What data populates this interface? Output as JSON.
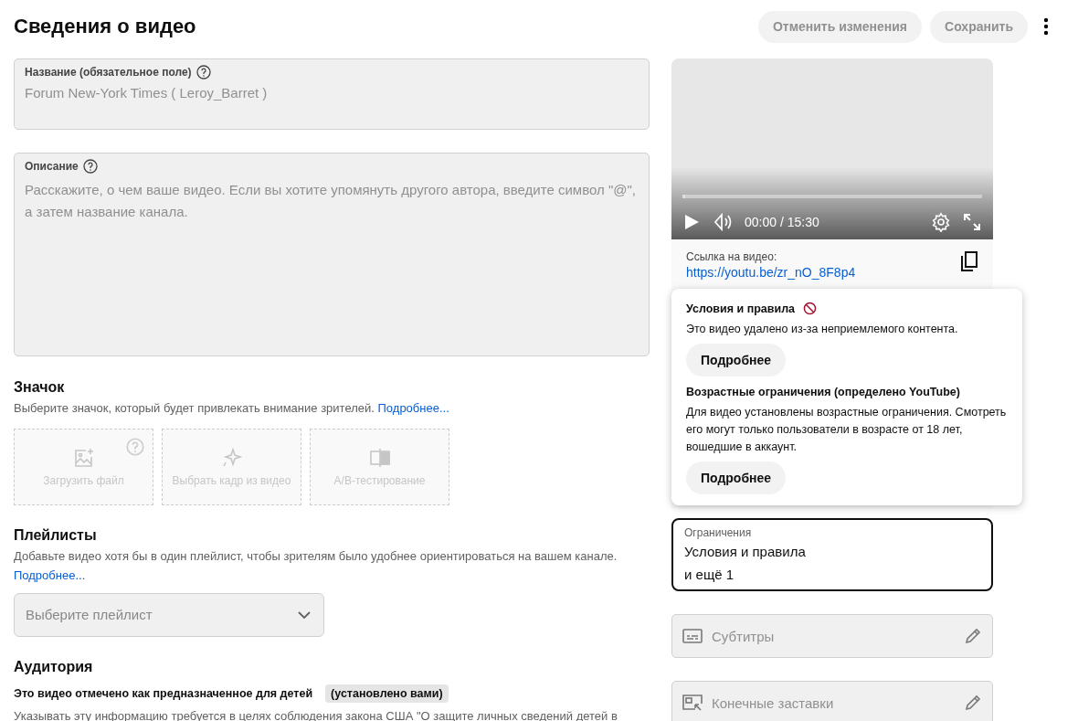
{
  "header": {
    "title": "Сведения о видео",
    "buttons": [
      "Отменить изменения",
      "Сохранить"
    ]
  },
  "title_field": {
    "label": "Название (обязательное поле)",
    "value": "Forum New-York Times ( Leroy_Barret )"
  },
  "description_field": {
    "label": "Описание",
    "placeholder": "Расскажите, о чем ваше видео. Если вы хотите упомянуть другого автора, введите символ \"@\", а затем название канала."
  },
  "thumbnail": {
    "heading": "Значок",
    "text": "Выберите значок, который будет привлекать внимание зрителей.",
    "link": "Подробнее...",
    "tiles": [
      {
        "kind": "upload",
        "label": "Загрузить файл"
      },
      {
        "kind": "frame",
        "label": "Выбрать кадр из видео"
      },
      {
        "kind": "ab",
        "label": "A/B-тестирование"
      }
    ]
  },
  "playlists": {
    "heading": "Плейлисты",
    "text": "Добавьте видео хотя бы в один плейлист, чтобы зрителям было удобнее ориентироваться на вашем канале.",
    "link": "Подробнее...",
    "placeholder": "Выберите плейлист"
  },
  "audience": {
    "heading": "Аудитория",
    "status": "Это видео отмечено как предназначенное для детей",
    "chip": "(установлено вами)",
    "note": "Указывать эту информацию требуется в целях соблюдения закона США \"О защите личных сведений детей в"
  },
  "video": {
    "time": "00:00 / 15:30",
    "level": 0.01,
    "link_label": "Ссылка на видео:",
    "link": "https://youtu.be/zr_nO_8F8p4"
  },
  "popup": {
    "sections": [
      {
        "kind": "removed",
        "title": "Условия и правила",
        "text": "Это видео удалено из-за неприемлемого контента.",
        "button": "Подробнее"
      },
      {
        "kind": "age",
        "title": "Возрастные ограничения (определено YouTube)",
        "text": "Для видео установлены возрастные ограничения. Смотреть его могут только пользователи в возрасте от 18 лет, вошедшие в аккаунт.",
        "button": "Подробнее"
      }
    ]
  },
  "restrictions": {
    "label": "Ограничения",
    "lines": [
      "Условия и правила",
      "и ещё 1"
    ]
  },
  "side_fields": [
    {
      "kind": "subtitles",
      "label": "Субтитры"
    },
    {
      "kind": "end_screens",
      "label": "Конечные заставки"
    }
  ]
}
